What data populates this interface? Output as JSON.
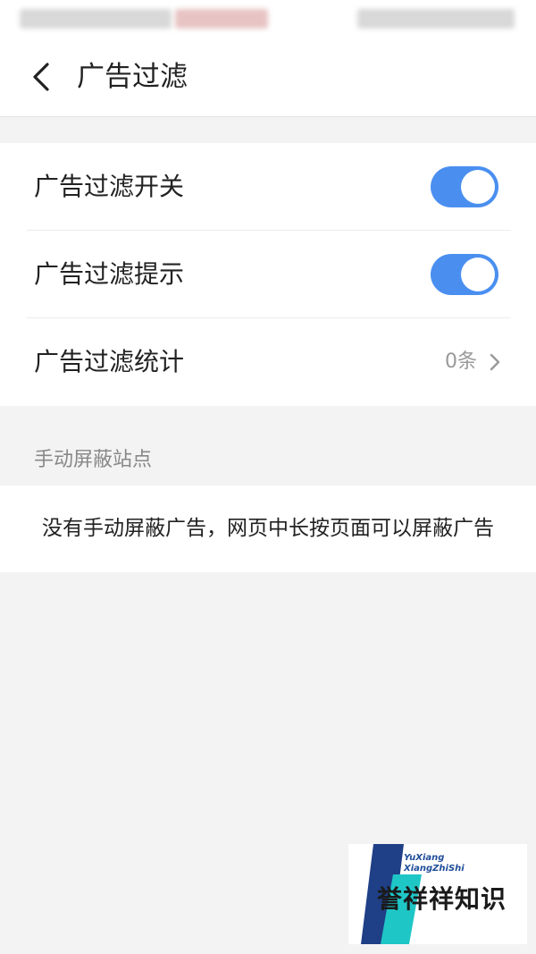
{
  "header": {
    "title": "广告过滤"
  },
  "settings": {
    "items": [
      {
        "label": "广告过滤开关",
        "toggle_on": true
      },
      {
        "label": "广告过滤提示",
        "toggle_on": true
      },
      {
        "label": "广告过滤统计",
        "value": "0条"
      }
    ]
  },
  "manual_block": {
    "section_label": "手动屏蔽站点",
    "empty_text": "没有手动屏蔽广告，网页中长按页面可以屏蔽广告"
  },
  "watermark": {
    "sub_line1": "YuXiang",
    "sub_line2": "XiangZhiShi",
    "main_text": "誉祥祥知识"
  },
  "colors": {
    "accent": "#4a8ff0",
    "background": "#f3f3f3",
    "card": "#ffffff",
    "secondary_text": "#999999"
  },
  "icons": {
    "back": "chevron-left-icon",
    "row_more": "chevron-right-icon"
  }
}
